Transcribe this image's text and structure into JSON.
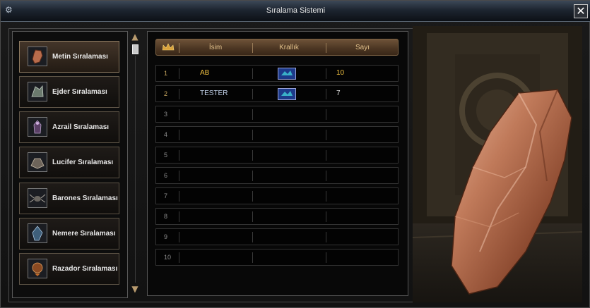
{
  "window": {
    "title": "Sıralama Sistemi",
    "close_icon": "close-icon"
  },
  "sidebar": {
    "items": [
      {
        "label": "Metin Sıralaması",
        "icon": "metin-stone-icon",
        "active": true
      },
      {
        "label": "Ejder Sıralaması",
        "icon": "dragon-icon",
        "active": false
      },
      {
        "label": "Azrail Sıralaması",
        "icon": "azrail-icon",
        "active": false
      },
      {
        "label": "Lucifer Sıralaması",
        "icon": "lucifer-icon",
        "active": false
      },
      {
        "label": "Barones Sıralaması",
        "icon": "spider-icon",
        "active": false
      },
      {
        "label": "Nemere Sıralaması",
        "icon": "nemere-icon",
        "active": false
      },
      {
        "label": "Razador Sıralaması",
        "icon": "razador-icon",
        "active": false
      }
    ]
  },
  "table": {
    "columns": {
      "rank_icon": "crown-icon",
      "name": "İsim",
      "kingdom": "Krallık",
      "count": "Sayı"
    },
    "rows": [
      {
        "rank": "1",
        "name": "AB",
        "kingdom": "blue-kingdom-flag",
        "count": "10"
      },
      {
        "rank": "2",
        "name": "TESTER",
        "kingdom": "blue-kingdom-flag",
        "count": "7"
      },
      {
        "rank": "3",
        "name": "",
        "kingdom": "",
        "count": ""
      },
      {
        "rank": "4",
        "name": "",
        "kingdom": "",
        "count": ""
      },
      {
        "rank": "5",
        "name": "",
        "kingdom": "",
        "count": ""
      },
      {
        "rank": "6",
        "name": "",
        "kingdom": "",
        "count": ""
      },
      {
        "rank": "7",
        "name": "",
        "kingdom": "",
        "count": ""
      },
      {
        "rank": "8",
        "name": "",
        "kingdom": "",
        "count": ""
      },
      {
        "rank": "9",
        "name": "",
        "kingdom": "",
        "count": ""
      },
      {
        "rank": "10",
        "name": "",
        "kingdom": "",
        "count": ""
      }
    ]
  },
  "colors": {
    "header_text": "#e2c08a",
    "first_place_text": "#f0c040",
    "other_text": "#c8d8f0",
    "kingdom_blue": "#1d3a8a"
  },
  "preview": {
    "subject": "metin-stone-image"
  }
}
